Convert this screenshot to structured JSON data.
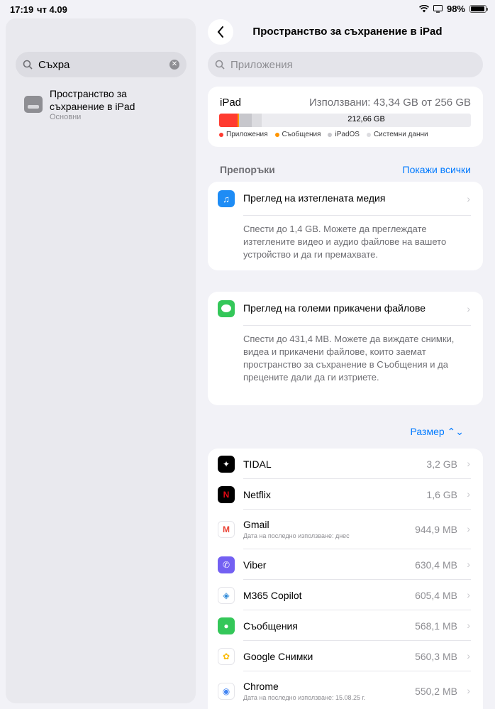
{
  "status": {
    "time": "17:19",
    "date": "чт 4.09",
    "battery": "98%"
  },
  "sidebar": {
    "search_value": "Съхра",
    "result": {
      "title": "Пространство за съхранение в iPad",
      "subtitle": "Основни"
    }
  },
  "header": {
    "title": "Пространство за съхранение в iPad"
  },
  "search": {
    "placeholder": "Приложения"
  },
  "storage": {
    "device": "iPad",
    "used_text": "Използвани: 43,34 GB от 256 GB",
    "free_text": "212,66 GB",
    "segments": [
      {
        "name": "Приложения",
        "fraction": 0.073,
        "color": "#ff3b30"
      },
      {
        "name": "Съобщения",
        "fraction": 0.006,
        "color": "#ff9500"
      },
      {
        "name": "iPadOS",
        "fraction": 0.05,
        "color": "#c7c7cc"
      },
      {
        "name": "Системни данни",
        "fraction": 0.04,
        "color": "#dcdce0"
      }
    ],
    "legend": [
      "Приложения",
      "Съобщения",
      "iPadOS",
      "Системни данни"
    ]
  },
  "recommendations": {
    "label": "Препоръки",
    "show_all": "Покажи всички",
    "items": [
      {
        "title": "Преглед на изтеглената медия",
        "body": "Спести до 1,4 GB. Можете да преглеждате изтеглените видео и аудио файлове на вашето устройство и да ги премахвате.",
        "icon": "music-icon",
        "color": "#1e8cf5"
      },
      {
        "title": "Преглед на големи прикачени файлове",
        "body": "Спести до 431,4 MB. Можете да виждате снимки, видеа и прикачени файлове, които заемат пространство за съхранение в Съобщения и да прецените дали да ги изтриете.",
        "icon": "messages-icon",
        "color": "#34c759"
      }
    ]
  },
  "sort": {
    "label": "Размер ⌃⌄"
  },
  "apps": [
    {
      "name": "TIDAL",
      "sub": "",
      "size": "3,2 GB",
      "icon": "tidal-icon",
      "bg": "#000000",
      "fg": "#ffffff",
      "glyph": "✦"
    },
    {
      "name": "Netflix",
      "sub": "",
      "size": "1,6 GB",
      "icon": "netflix-icon",
      "bg": "#000000",
      "fg": "#e50914",
      "glyph": "N"
    },
    {
      "name": "Gmail",
      "sub": "Дата на последно използване: днес",
      "size": "944,9 MB",
      "icon": "gmail-icon",
      "bg": "#ffffff",
      "fg": "#ea4335",
      "glyph": "M"
    },
    {
      "name": "Viber",
      "sub": "",
      "size": "630,4 MB",
      "icon": "viber-icon",
      "bg": "#7360f2",
      "fg": "#ffffff",
      "glyph": "✆"
    },
    {
      "name": "M365 Copilot",
      "sub": "",
      "size": "605,4 MB",
      "icon": "copilot-icon",
      "bg": "#ffffff",
      "fg": "#2b88d8",
      "glyph": "◈"
    },
    {
      "name": "Съобщения",
      "sub": "",
      "size": "568,1 MB",
      "icon": "messages-icon",
      "bg": "#34c759",
      "fg": "#ffffff",
      "glyph": "●"
    },
    {
      "name": "Google Снимки",
      "sub": "",
      "size": "560,3 MB",
      "icon": "google-photos-icon",
      "bg": "#ffffff",
      "fg": "#fbbc04",
      "glyph": "✿"
    },
    {
      "name": "Chrome",
      "sub": "Дата на последно използване: 15.08.25 г.",
      "size": "550,2 MB",
      "icon": "chrome-icon",
      "bg": "#ffffff",
      "fg": "#4285f4",
      "glyph": "◉"
    }
  ]
}
